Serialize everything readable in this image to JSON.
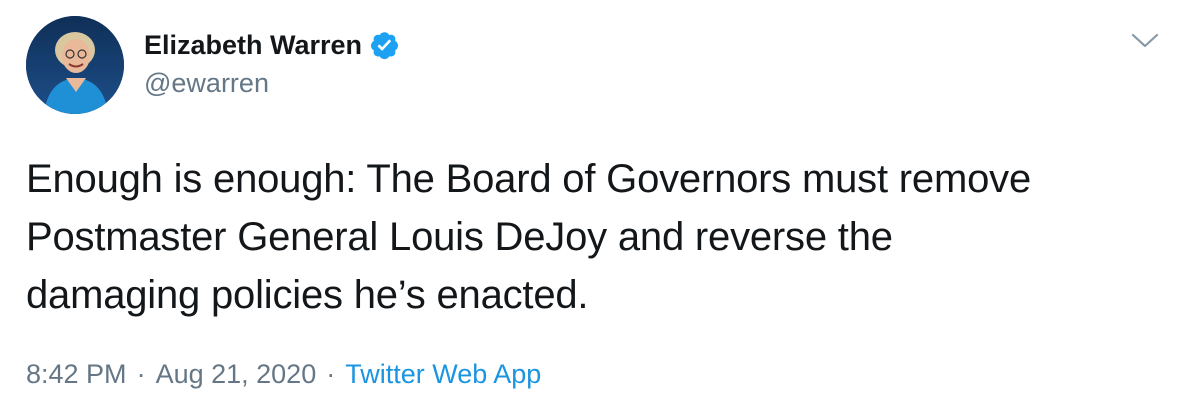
{
  "tweet": {
    "author": {
      "name": "Elizabeth Warren",
      "handle": "@ewarren",
      "verified": true,
      "avatar_icon": "profile-photo"
    },
    "text": "Enough is enough: The Board of Governors must remove\nPostmaster General Louis DeJoy and reverse the\ndamaging policies he’s enacted.",
    "time": "8:42 PM",
    "separator": "·",
    "date": "Aug 21, 2020",
    "source": "Twitter Web App",
    "menu_icon": "chevron-down-icon"
  },
  "colors": {
    "text": "#14171a",
    "secondary": "#657786",
    "link": "#1b95e0",
    "verified": "#1da1f2"
  }
}
